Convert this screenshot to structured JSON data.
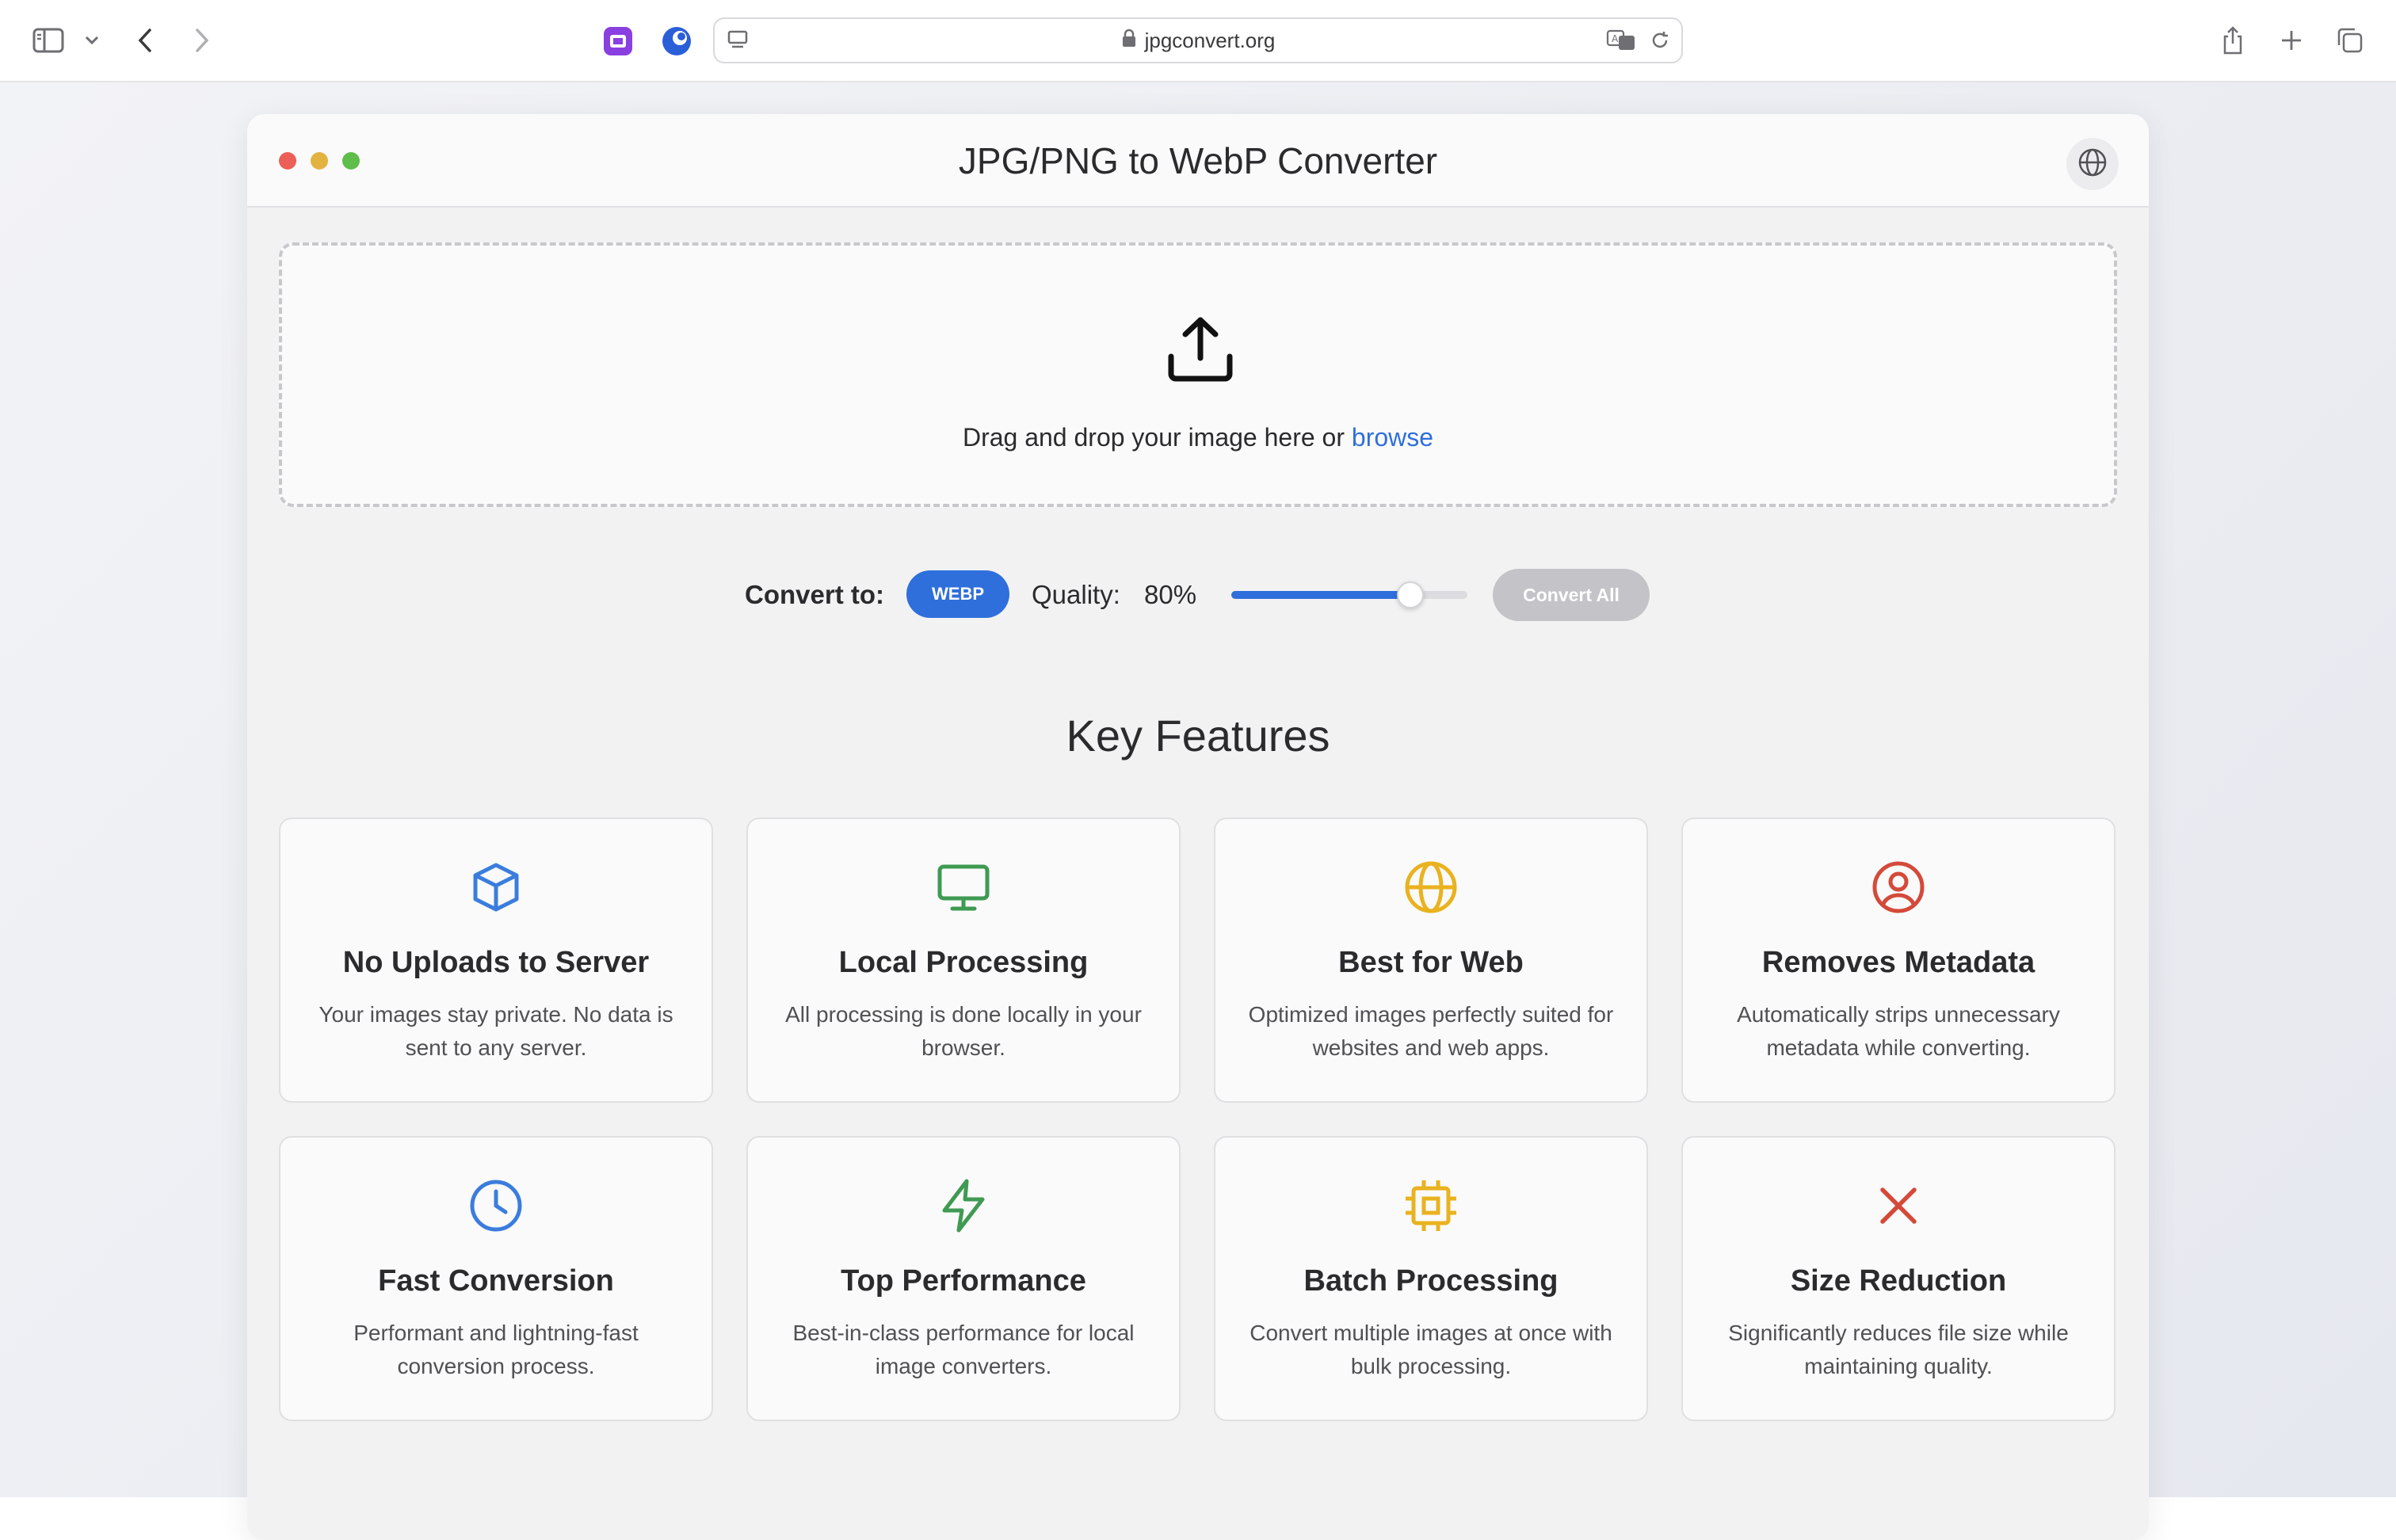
{
  "browser": {
    "url": "jpgconvert.org"
  },
  "app": {
    "title": "JPG/PNG to WebP Converter"
  },
  "dropzone": {
    "text": "Drag and drop your image here or ",
    "browse_label": "browse"
  },
  "controls": {
    "convert_label": "Convert to:",
    "format": "WEBP",
    "quality_label": "Quality:",
    "quality_value": "80%",
    "quality_fraction": 0.8,
    "convert_all_label": "Convert All"
  },
  "features": {
    "title": "Key Features",
    "items": [
      {
        "title": "No Uploads to Server",
        "desc": "Your images stay private. No data is sent to any server.",
        "icon": "cube-icon",
        "color": "#3b7ddd"
      },
      {
        "title": "Local Processing",
        "desc": "All processing is done locally in your browser.",
        "icon": "monitor-icon",
        "color": "#3f9a52"
      },
      {
        "title": "Best for Web",
        "desc": "Optimized images perfectly suited for websites and web apps.",
        "icon": "globe-icon",
        "color": "#e9b21f"
      },
      {
        "title": "Removes Metadata",
        "desc": "Automatically strips unnecessary metadata while converting.",
        "icon": "user-circle-icon",
        "color": "#d44a3a"
      },
      {
        "title": "Fast Conversion",
        "desc": "Performant and lightning-fast conversion process.",
        "icon": "clock-icon",
        "color": "#3b7ddd"
      },
      {
        "title": "Top Performance",
        "desc": "Best-in-class performance for local image converters.",
        "icon": "lightning-icon",
        "color": "#3f9a52"
      },
      {
        "title": "Batch Processing",
        "desc": "Convert multiple images at once with bulk processing.",
        "icon": "chip-icon",
        "color": "#e9b21f"
      },
      {
        "title": "Size Reduction",
        "desc": "Significantly reduces file size while maintaining quality.",
        "icon": "x-icon",
        "color": "#d44a3a"
      }
    ]
  },
  "colors": {
    "accent": "#2f6fdb",
    "traffic_red": "#ec5f57",
    "traffic_yellow": "#e3b340",
    "traffic_green": "#5fbd4a"
  }
}
